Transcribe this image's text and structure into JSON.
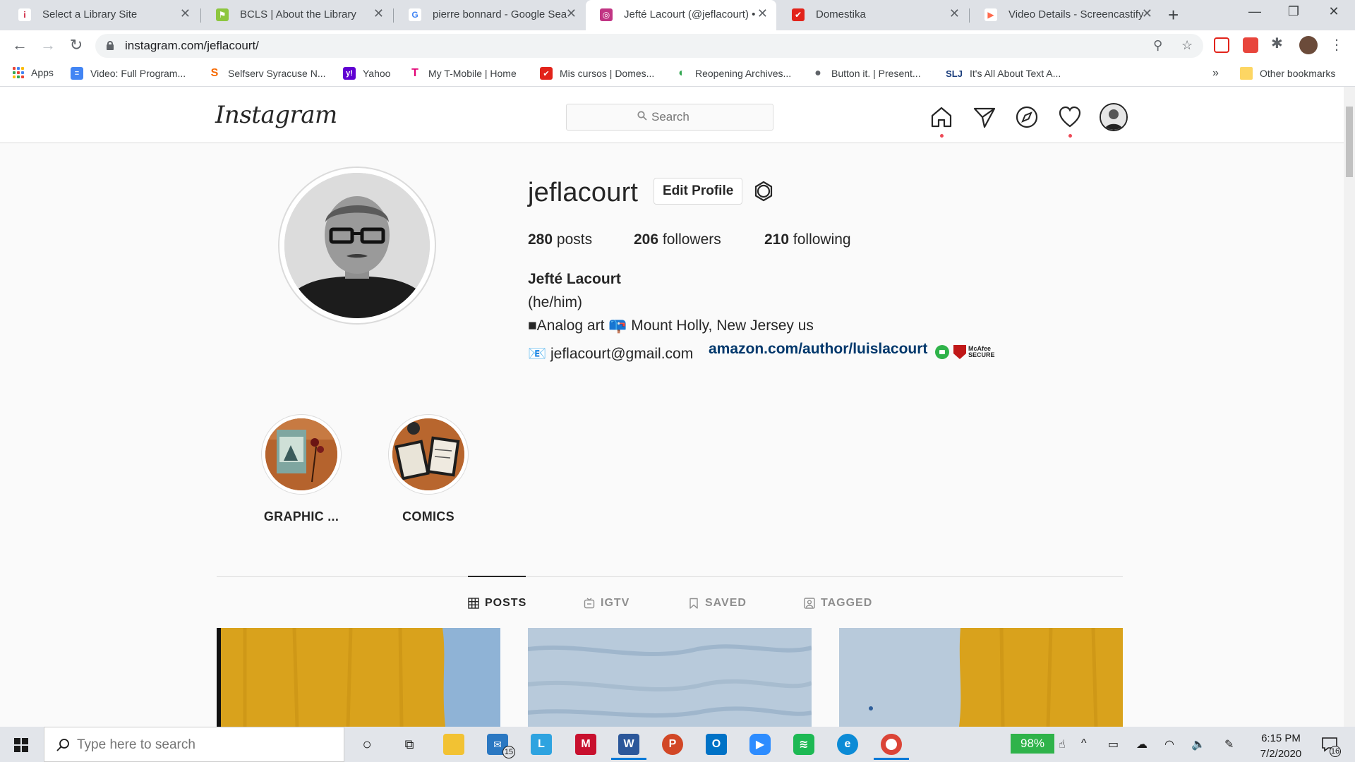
{
  "browser": {
    "tabs": [
      {
        "title": "Select a Library Site",
        "favicon": "library-icon",
        "color": "#c8102e",
        "glyph": "i"
      },
      {
        "title": "BCLS | About the Library",
        "favicon": "bcls-icon",
        "color": "#8dc63f",
        "glyph": "⚑"
      },
      {
        "title": "pierre bonnard - Google Sea",
        "favicon": "google-icon",
        "color": "#4285f4",
        "glyph": "G"
      },
      {
        "title": "Jefté Lacourt (@jeflacourt) •",
        "favicon": "instagram-icon",
        "color": "#c13584",
        "glyph": "◎"
      },
      {
        "title": "Domestika",
        "favicon": "domestika-icon",
        "color": "#e2231a",
        "glyph": "✔"
      },
      {
        "title": "Video Details - Screencastify",
        "favicon": "screencastify-icon",
        "color": "#ff6a4d",
        "glyph": "▶"
      }
    ],
    "new_tab_label": "+",
    "window_controls": {
      "minimize": "—",
      "maximize": "❐",
      "close": "✕"
    },
    "url": "instagram.com/jeflacourt/",
    "bookmarks": [
      {
        "label": "Apps",
        "icon": "apps-grid-icon"
      },
      {
        "label": "Video: Full Program...",
        "icon": "docs-icon",
        "color": "#4285f4",
        "glyph": "≡"
      },
      {
        "label": "Selfserv Syracuse N...",
        "icon": "selfserv-icon",
        "color": "#f76900",
        "glyph": "S"
      },
      {
        "label": "Yahoo",
        "icon": "yahoo-icon",
        "color": "#6001d2",
        "glyph": "y!"
      },
      {
        "label": "My T-Mobile | Home",
        "icon": "tmobile-icon",
        "color": "#e20074",
        "glyph": "T"
      },
      {
        "label": "Mis cursos | Domes...",
        "icon": "domestika-icon",
        "color": "#e2231a",
        "glyph": "✔"
      },
      {
        "label": "Reopening Archives...",
        "icon": "archives-icon",
        "color": "#34a853",
        "glyph": "◐"
      },
      {
        "label": "Button it. | Present...",
        "icon": "globe-icon",
        "color": "#5f6368",
        "glyph": "●"
      },
      {
        "label": "It's All About Text A...",
        "icon": "slj-icon",
        "color": "#ffffff",
        "glyph": "SLJ"
      }
    ],
    "overflow_label": "»",
    "other_bookmarks": "Other bookmarks"
  },
  "instagram": {
    "logo": "Instagram",
    "search_placeholder": "Search",
    "profile": {
      "username": "jeflacourt",
      "edit_button": "Edit Profile",
      "stats": {
        "posts_count": "280",
        "posts_label": "posts",
        "followers_count": "206",
        "followers_label": "followers",
        "following_count": "210",
        "following_label": "following"
      },
      "full_name": "Jefté Lacourt",
      "bio_lines": [
        "(he/him)",
        "■Analog art 📪 Mount Holly, New Jersey us",
        "📧 jeflacourt@gmail.com"
      ],
      "link": "amazon.com/author/luislacourt",
      "badge_text_1": "McAfee",
      "badge_text_2": "SECURE"
    },
    "highlights": [
      {
        "label": "GRAPHIC ..."
      },
      {
        "label": "COMICS"
      }
    ],
    "tabs": [
      {
        "label": "POSTS",
        "active": true
      },
      {
        "label": "IGTV",
        "active": false
      },
      {
        "label": "SAVED",
        "active": false
      },
      {
        "label": "TAGGED",
        "active": false
      }
    ]
  },
  "taskbar": {
    "search_placeholder": "Type here to search",
    "mail_badge": "15",
    "battery": "98%",
    "time": "6:15 PM",
    "date": "7/2/2020",
    "notification_count": "16"
  }
}
